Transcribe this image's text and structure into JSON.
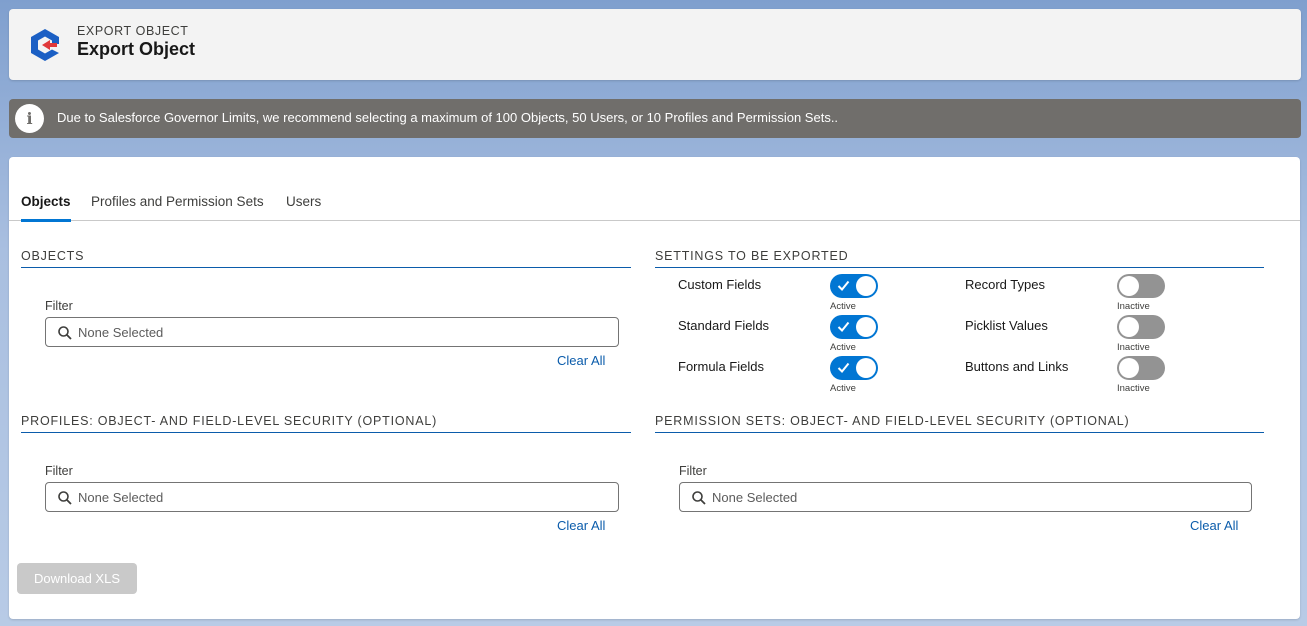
{
  "header": {
    "eyebrow": "EXPORT OBJECT",
    "title": "Export Object",
    "logo_icon": "export-object-logo"
  },
  "banner": {
    "icon": "info-icon",
    "text": "Due to Salesforce Governor Limits, we recommend selecting a maximum of 100 Objects, 50 Users, or 10 Profiles and Permission Sets.."
  },
  "tabs": [
    {
      "label": "Objects",
      "active": true
    },
    {
      "label": "Profiles and Permission Sets",
      "active": false
    },
    {
      "label": "Users",
      "active": false
    }
  ],
  "objects": {
    "title": "OBJECTS",
    "filter_label": "Filter",
    "placeholder": "None Selected",
    "clear": "Clear All"
  },
  "settings": {
    "title": "SETTINGS TO BE EXPORTED",
    "items": [
      {
        "label": "Custom Fields",
        "state": "Active",
        "on": true
      },
      {
        "label": "Standard Fields",
        "state": "Active",
        "on": true
      },
      {
        "label": "Formula Fields",
        "state": "Active",
        "on": true
      },
      {
        "label": "Record Types",
        "state": "Inactive",
        "on": false
      },
      {
        "label": "Picklist Values",
        "state": "Inactive",
        "on": false
      },
      {
        "label": "Buttons and Links",
        "state": "Inactive",
        "on": false
      }
    ]
  },
  "profiles": {
    "title": "PROFILES: OBJECT- AND FIELD-LEVEL SECURITY (OPTIONAL)",
    "filter_label": "Filter",
    "placeholder": "None Selected",
    "clear": "Clear All"
  },
  "permission_sets": {
    "title": "PERMISSION SETS: OBJECT- AND FIELD-LEVEL SECURITY (OPTIONAL)",
    "filter_label": "Filter",
    "placeholder": "None Selected",
    "clear": "Clear All"
  },
  "download_button": "Download XLS",
  "colors": {
    "accent": "#0176d3",
    "link": "#0b5cab",
    "banner": "#706e6b",
    "toggle_off": "#939393",
    "logo_blue": "#1b5fc4",
    "logo_red": "#e0383a"
  }
}
